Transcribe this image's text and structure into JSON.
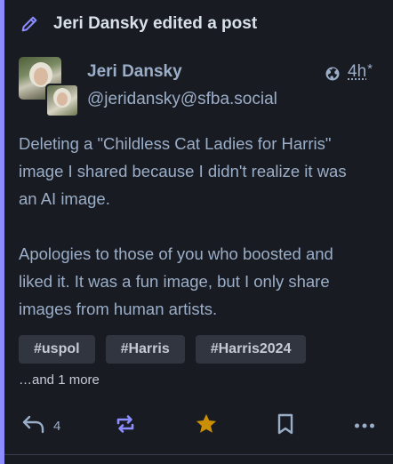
{
  "header": {
    "title": "Jeri Dansky edited a post",
    "icon": "pencil-icon",
    "accent_color": "#8c8dff"
  },
  "status": {
    "display_name": "Jeri Dansky",
    "handle": "@jeridansky@sfba.social",
    "visibility_icon": "globe-icon",
    "time": "4h",
    "edited_mark": "*",
    "paragraphs": [
      "Deleting a \"Childless Cat Ladies for Harris\"\nimage I shared because I didn't realize it was\nan AI image.",
      "Apologies to those of you who boosted and\nliked it. It was a fun image, but I only share\nimages from human artists."
    ],
    "tags": [
      "#uspol",
      "#Harris",
      "#Harris2024"
    ],
    "more_tags": "…and 1 more"
  },
  "actions": {
    "reply_count": "4",
    "reply_icon": "reply-icon",
    "boost_icon": "boost-icon",
    "boost_color": "#8c8dff",
    "favourite_icon": "star-icon",
    "favourite_color": "#ca8f04",
    "bookmark_icon": "bookmark-icon",
    "more_icon": "more-horizontal-icon"
  }
}
